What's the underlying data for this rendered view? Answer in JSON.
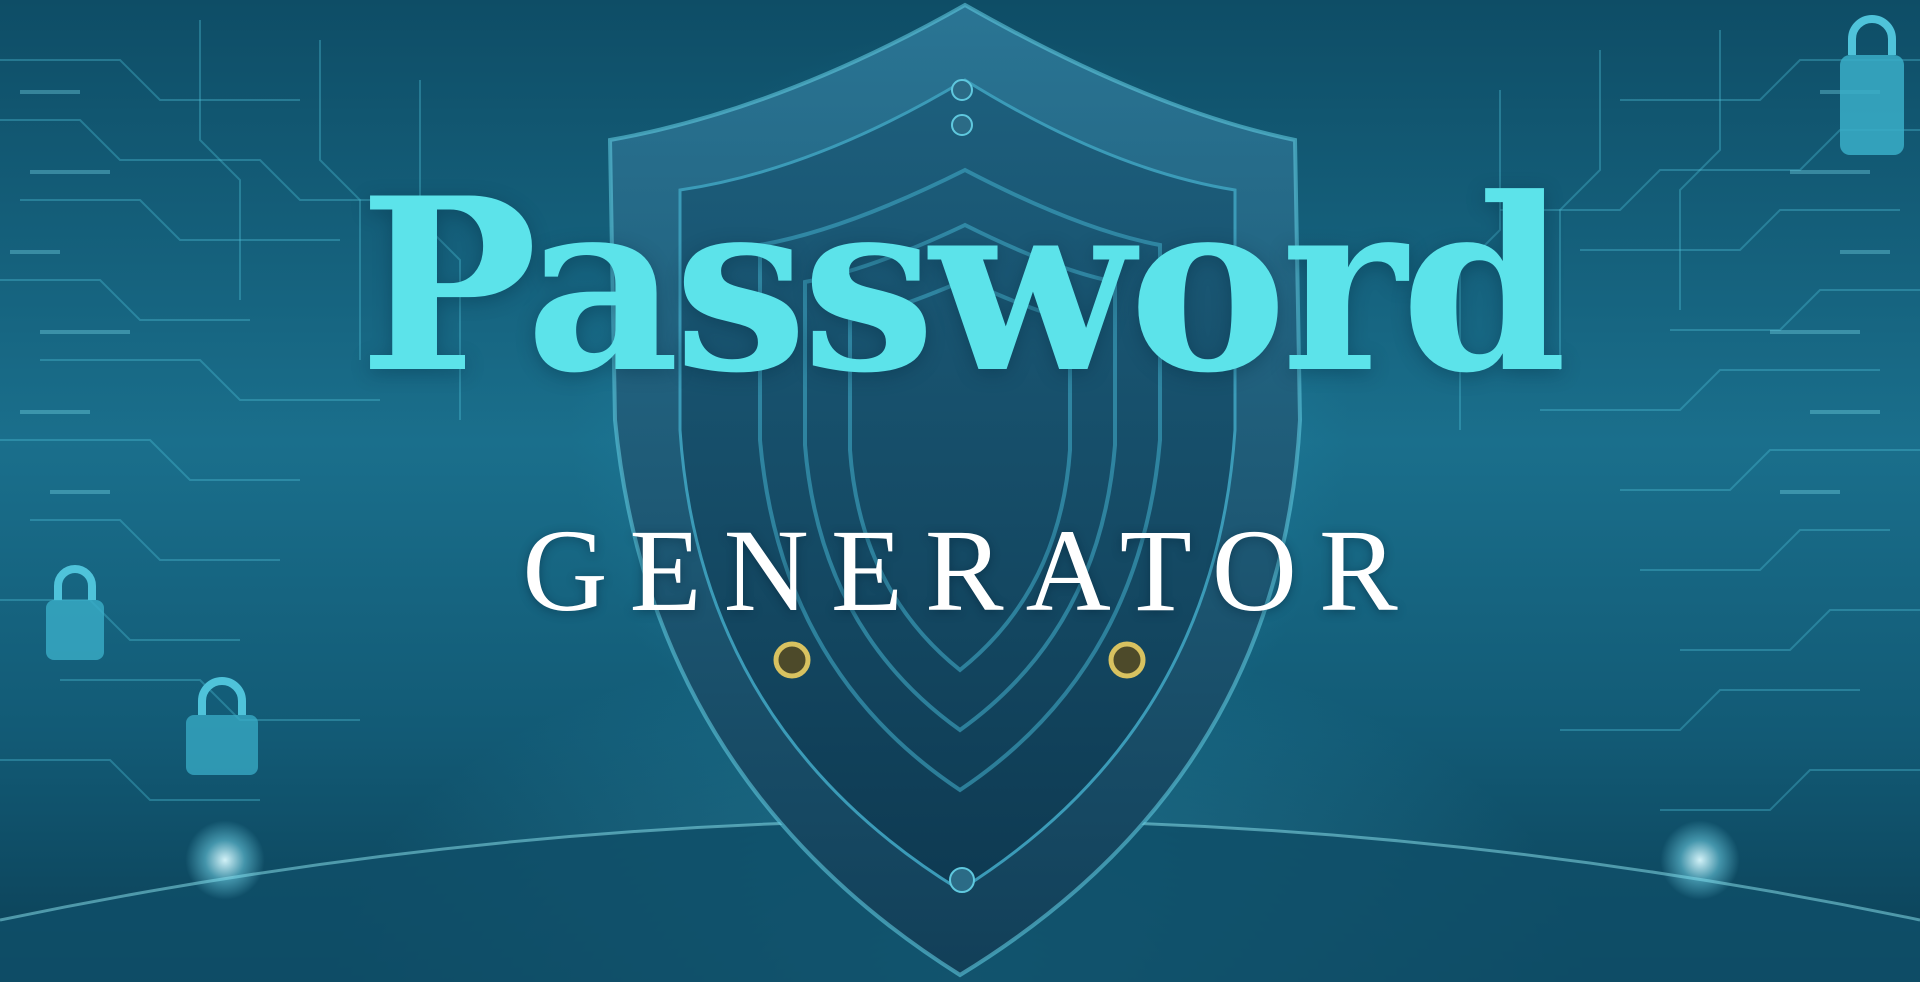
{
  "banner": {
    "title": "Password",
    "subtitle": "GENERATOR"
  },
  "colors": {
    "title": "#5ce3ea",
    "subtitle": "#ffffff",
    "background_dark": "#0b3b4f",
    "background_mid": "#1a6f8c",
    "shield": "#1e5b78",
    "bolt_gold": "#d8c260"
  },
  "icons": [
    "shield-icon",
    "lock-icon",
    "circuit-pattern"
  ]
}
